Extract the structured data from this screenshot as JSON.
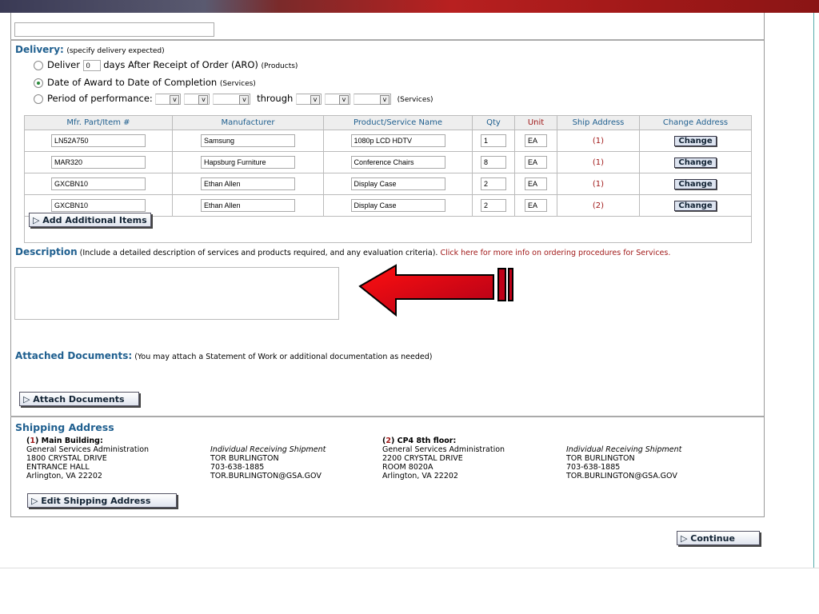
{
  "top_input": "",
  "delivery": {
    "title": "Delivery:",
    "note": "(specify delivery expected)",
    "opt1_pre": "Deliver",
    "opt1_value": "0",
    "opt1_post": "days After Receipt of Order (ARO)",
    "opt1_note": "(Products)",
    "opt2": "Date of Award to Date of Completion",
    "opt2_note": "(Services)",
    "opt3": "Period of performance:",
    "through": "through",
    "opt3_note": "(Services)",
    "selected": 2
  },
  "table": {
    "headers": [
      "Mfr. Part/Item #",
      "Manufacturer",
      "Product/Service Name",
      "Qty",
      "Unit",
      "Ship Address",
      "Change Address"
    ],
    "rows": [
      {
        "part": "LN52A750",
        "mfr": "Samsung",
        "name": "1080p LCD HDTV",
        "qty": "1",
        "unit": "EA",
        "ship": "(1)"
      },
      {
        "part": "MAR320",
        "mfr": "Hapsburg Furniture",
        "name": "Conference Chairs",
        "qty": "8",
        "unit": "EA",
        "ship": "(1)"
      },
      {
        "part": "GXCBN10",
        "mfr": "Ethan Allen",
        "name": "Display Case",
        "qty": "2",
        "unit": "EA",
        "ship": "(1)"
      },
      {
        "part": "GXCBN10",
        "mfr": "Ethan Allen",
        "name": "Display Case",
        "qty": "2",
        "unit": "EA",
        "ship": "(2)"
      }
    ],
    "change_label": "Change",
    "add_label": "Add Additional Items"
  },
  "description": {
    "title": "Description",
    "note": "(Include a detailed description of services and products required, and any evaluation criteria).",
    "link": "Click here for more info on ordering procedures for Services.",
    "value": ""
  },
  "attached": {
    "title": "Attached Documents:",
    "note": "(You may attach a Statement of Work or additional documentation as needed)",
    "button": "Attach Documents"
  },
  "shipping": {
    "title": "Shipping Address",
    "addresses": [
      {
        "num": "1",
        "label": "Main Building:",
        "lines": [
          "General Services Administration",
          "1800 CRYSTAL DRIVE",
          "ENTRANCE HALL",
          "Arlington, VA  22202"
        ],
        "contact": [
          "Individual Receiving Shipment",
          "TOR BURLINGTON",
          "703-638-1885",
          "TOR.BURLINGTON@GSA.GOV"
        ]
      },
      {
        "num": "2",
        "label": "CP4 8th floor:",
        "lines": [
          "General Services Administration",
          "2200 CRYSTAL DRIVE",
          "ROOM 8020A",
          "Arlington, VA  22202"
        ],
        "contact": [
          "Individual Receiving Shipment",
          "TOR BURLINGTON",
          "703-638-1885",
          "TOR.BURLINGTON@GSA.GOV"
        ]
      }
    ],
    "edit_button": "Edit Shipping Address"
  },
  "continue_label": "Continue",
  "colors": {
    "heading": "#1f5f8f",
    "accent_red": "#a01818",
    "arrow": "#e00010"
  }
}
